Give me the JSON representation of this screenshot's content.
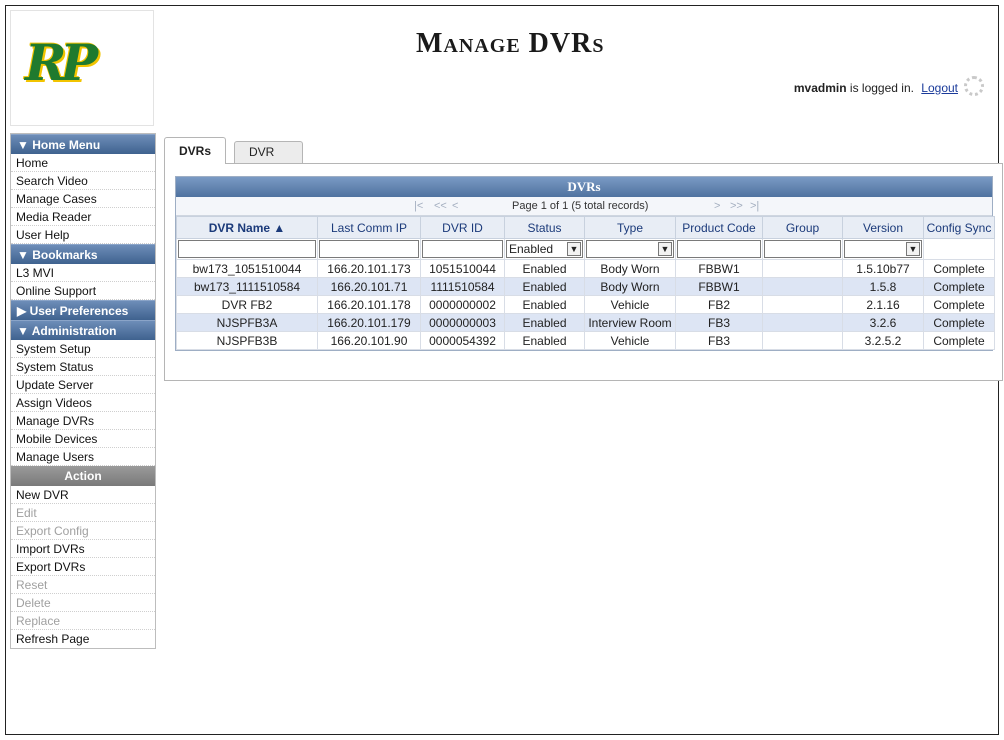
{
  "header": {
    "logo_text": "RP",
    "title": "Manage DVRs",
    "user": "mvadmin",
    "logged_in_text": "is logged in.",
    "logout_label": "Logout"
  },
  "sidebar": {
    "home_menu": {
      "label": "▼ Home Menu",
      "items": [
        "Home",
        "Search Video",
        "Manage Cases",
        "Media Reader",
        "User Help"
      ]
    },
    "bookmarks": {
      "label": "▼  Bookmarks",
      "items": [
        "L3 MVI",
        "Online Support"
      ]
    },
    "user_preferences": {
      "label": "▶ User Preferences"
    },
    "administration": {
      "label": "▼  Administration",
      "items": [
        "System Setup",
        "System Status",
        "Update Server",
        "Assign Videos",
        "Manage DVRs",
        "Mobile Devices",
        "Manage Users"
      ]
    },
    "action": {
      "label": "Action",
      "items": [
        {
          "label": "New DVR",
          "enabled": true
        },
        {
          "label": "Edit",
          "enabled": false
        },
        {
          "label": "Export Config",
          "enabled": false
        },
        {
          "label": "Import DVRs",
          "enabled": true
        },
        {
          "label": "Export DVRs",
          "enabled": true
        },
        {
          "label": "Reset",
          "enabled": false
        },
        {
          "label": "Delete",
          "enabled": false
        },
        {
          "label": "Replace",
          "enabled": false
        },
        {
          "label": "Refresh Page",
          "enabled": true
        }
      ]
    }
  },
  "tabs": [
    {
      "label": "DVRs",
      "active": true
    },
    {
      "label": "DVR Groups",
      "active": false
    }
  ],
  "grid": {
    "title": "DVRs",
    "pager": {
      "first": "|<",
      "prev_block": "<<",
      "prev": "<",
      "text": "Page 1 of 1 (5 total records)",
      "next": ">",
      "next_block": ">>",
      "last": ">|"
    },
    "columns": [
      "DVR Name ▲",
      "Last Comm IP",
      "DVR ID",
      "Status",
      "Type",
      "Product Code",
      "Group",
      "Version",
      "Config Sync"
    ],
    "filters": {
      "status_value": "Enabled",
      "type_value": "",
      "version_value": ""
    },
    "rows": [
      [
        "bw173_1051510044",
        "166.20.101.173",
        "1051510044",
        "Enabled",
        "Body Worn",
        "FBBW1",
        "",
        "1.5.10b77",
        "Complete"
      ],
      [
        "bw173_1111510584",
        "166.20.101.71",
        "1111510584",
        "Enabled",
        "Body Worn",
        "FBBW1",
        "",
        "1.5.8",
        "Complete"
      ],
      [
        "DVR FB2",
        "166.20.101.178",
        "0000000002",
        "Enabled",
        "Vehicle",
        "FB2",
        "",
        "2.1.16",
        "Complete"
      ],
      [
        "NJSPFB3A",
        "166.20.101.179",
        "0000000003",
        "Enabled",
        "Interview Room",
        "FB3",
        "",
        "3.2.6",
        "Complete"
      ],
      [
        "NJSPFB3B",
        "166.20.101.90",
        "0000054392",
        "Enabled",
        "Vehicle",
        "FB3",
        "",
        "3.2.5.2",
        "Complete"
      ]
    ]
  }
}
